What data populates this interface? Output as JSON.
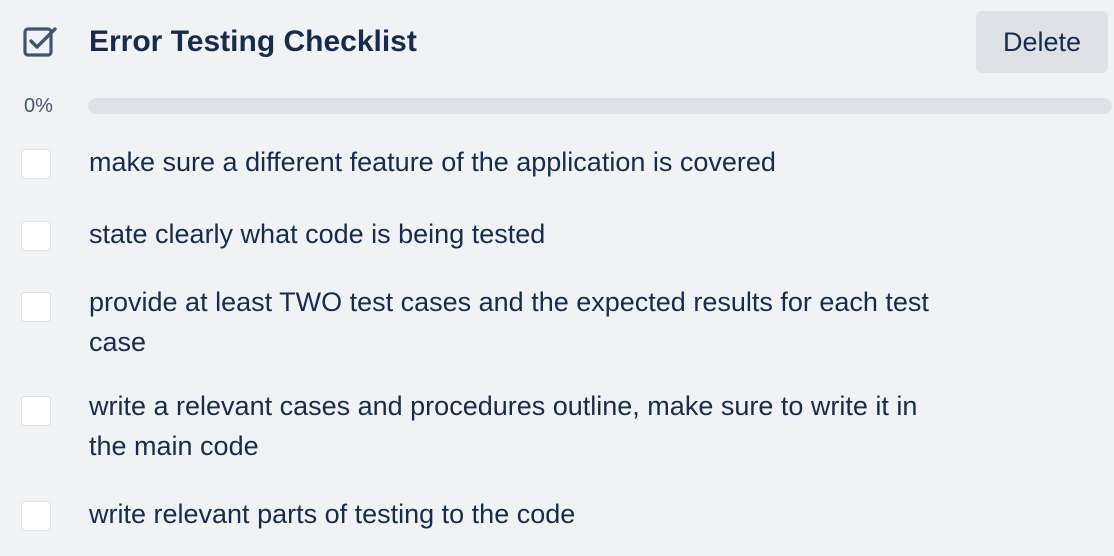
{
  "checklist": {
    "title": "Error Testing Checklist",
    "icon": "checkbox-checked-icon",
    "delete_label": "Delete",
    "progress_label": "0%",
    "progress_fraction": 0,
    "items": [
      {
        "text": "make sure a different feature of the application is covered",
        "checked": false
      },
      {
        "text": "state clearly what code is being tested",
        "checked": false
      },
      {
        "text": "provide at least TWO test cases and the expected results for each test case",
        "checked": false
      },
      {
        "text": "write a relevant cases and procedures outline, make sure to write it in the main code",
        "checked": false
      },
      {
        "text": "write relevant parts of testing to the code",
        "checked": false
      }
    ]
  },
  "colors": {
    "background": "#f1f2f4",
    "text": "#172b4d",
    "button_bg": "#dfe1e6",
    "progress_track": "#dfe1e6",
    "checkbox_bg": "#ffffff"
  }
}
